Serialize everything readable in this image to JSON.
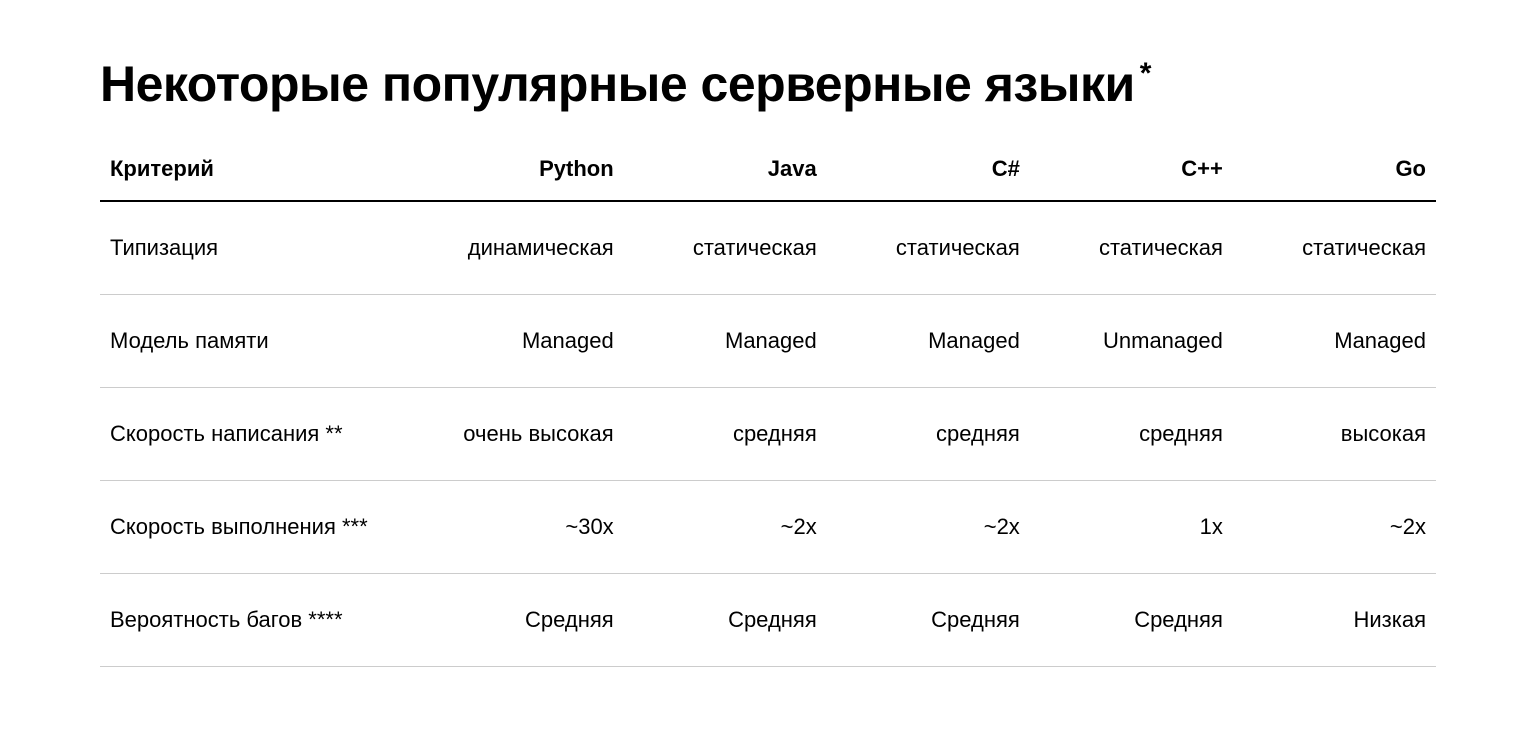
{
  "title": "Некоторые популярные серверные языки",
  "title_asterisk": "*",
  "chart_data": {
    "type": "table",
    "headers": [
      "Критерий",
      "Python",
      "Java",
      "C#",
      "C++",
      "Go"
    ],
    "rows": [
      {
        "criterion": "Типизация",
        "python": "динамическая",
        "java": "статическая",
        "csharp": "статическая",
        "cpp": "статическая",
        "go": "статическая"
      },
      {
        "criterion": "Модель памяти",
        "python": "Managed",
        "java": "Managed",
        "csharp": "Managed",
        "cpp": "Unmanaged",
        "go": "Managed"
      },
      {
        "criterion": "Скорость написания **",
        "python": "очень высокая",
        "java": "средняя",
        "csharp": "средняя",
        "cpp": "средняя",
        "go": "высокая"
      },
      {
        "criterion": "Скорость выполнения ***",
        "python": "~30x",
        "java": "~2x",
        "csharp": "~2x",
        "cpp": "1x",
        "go": "~2x"
      },
      {
        "criterion": "Вероятность багов ****",
        "python": "Средняя",
        "java": "Средняя",
        "csharp": "Средняя",
        "cpp": "Средняя",
        "go": "Низкая"
      }
    ]
  }
}
